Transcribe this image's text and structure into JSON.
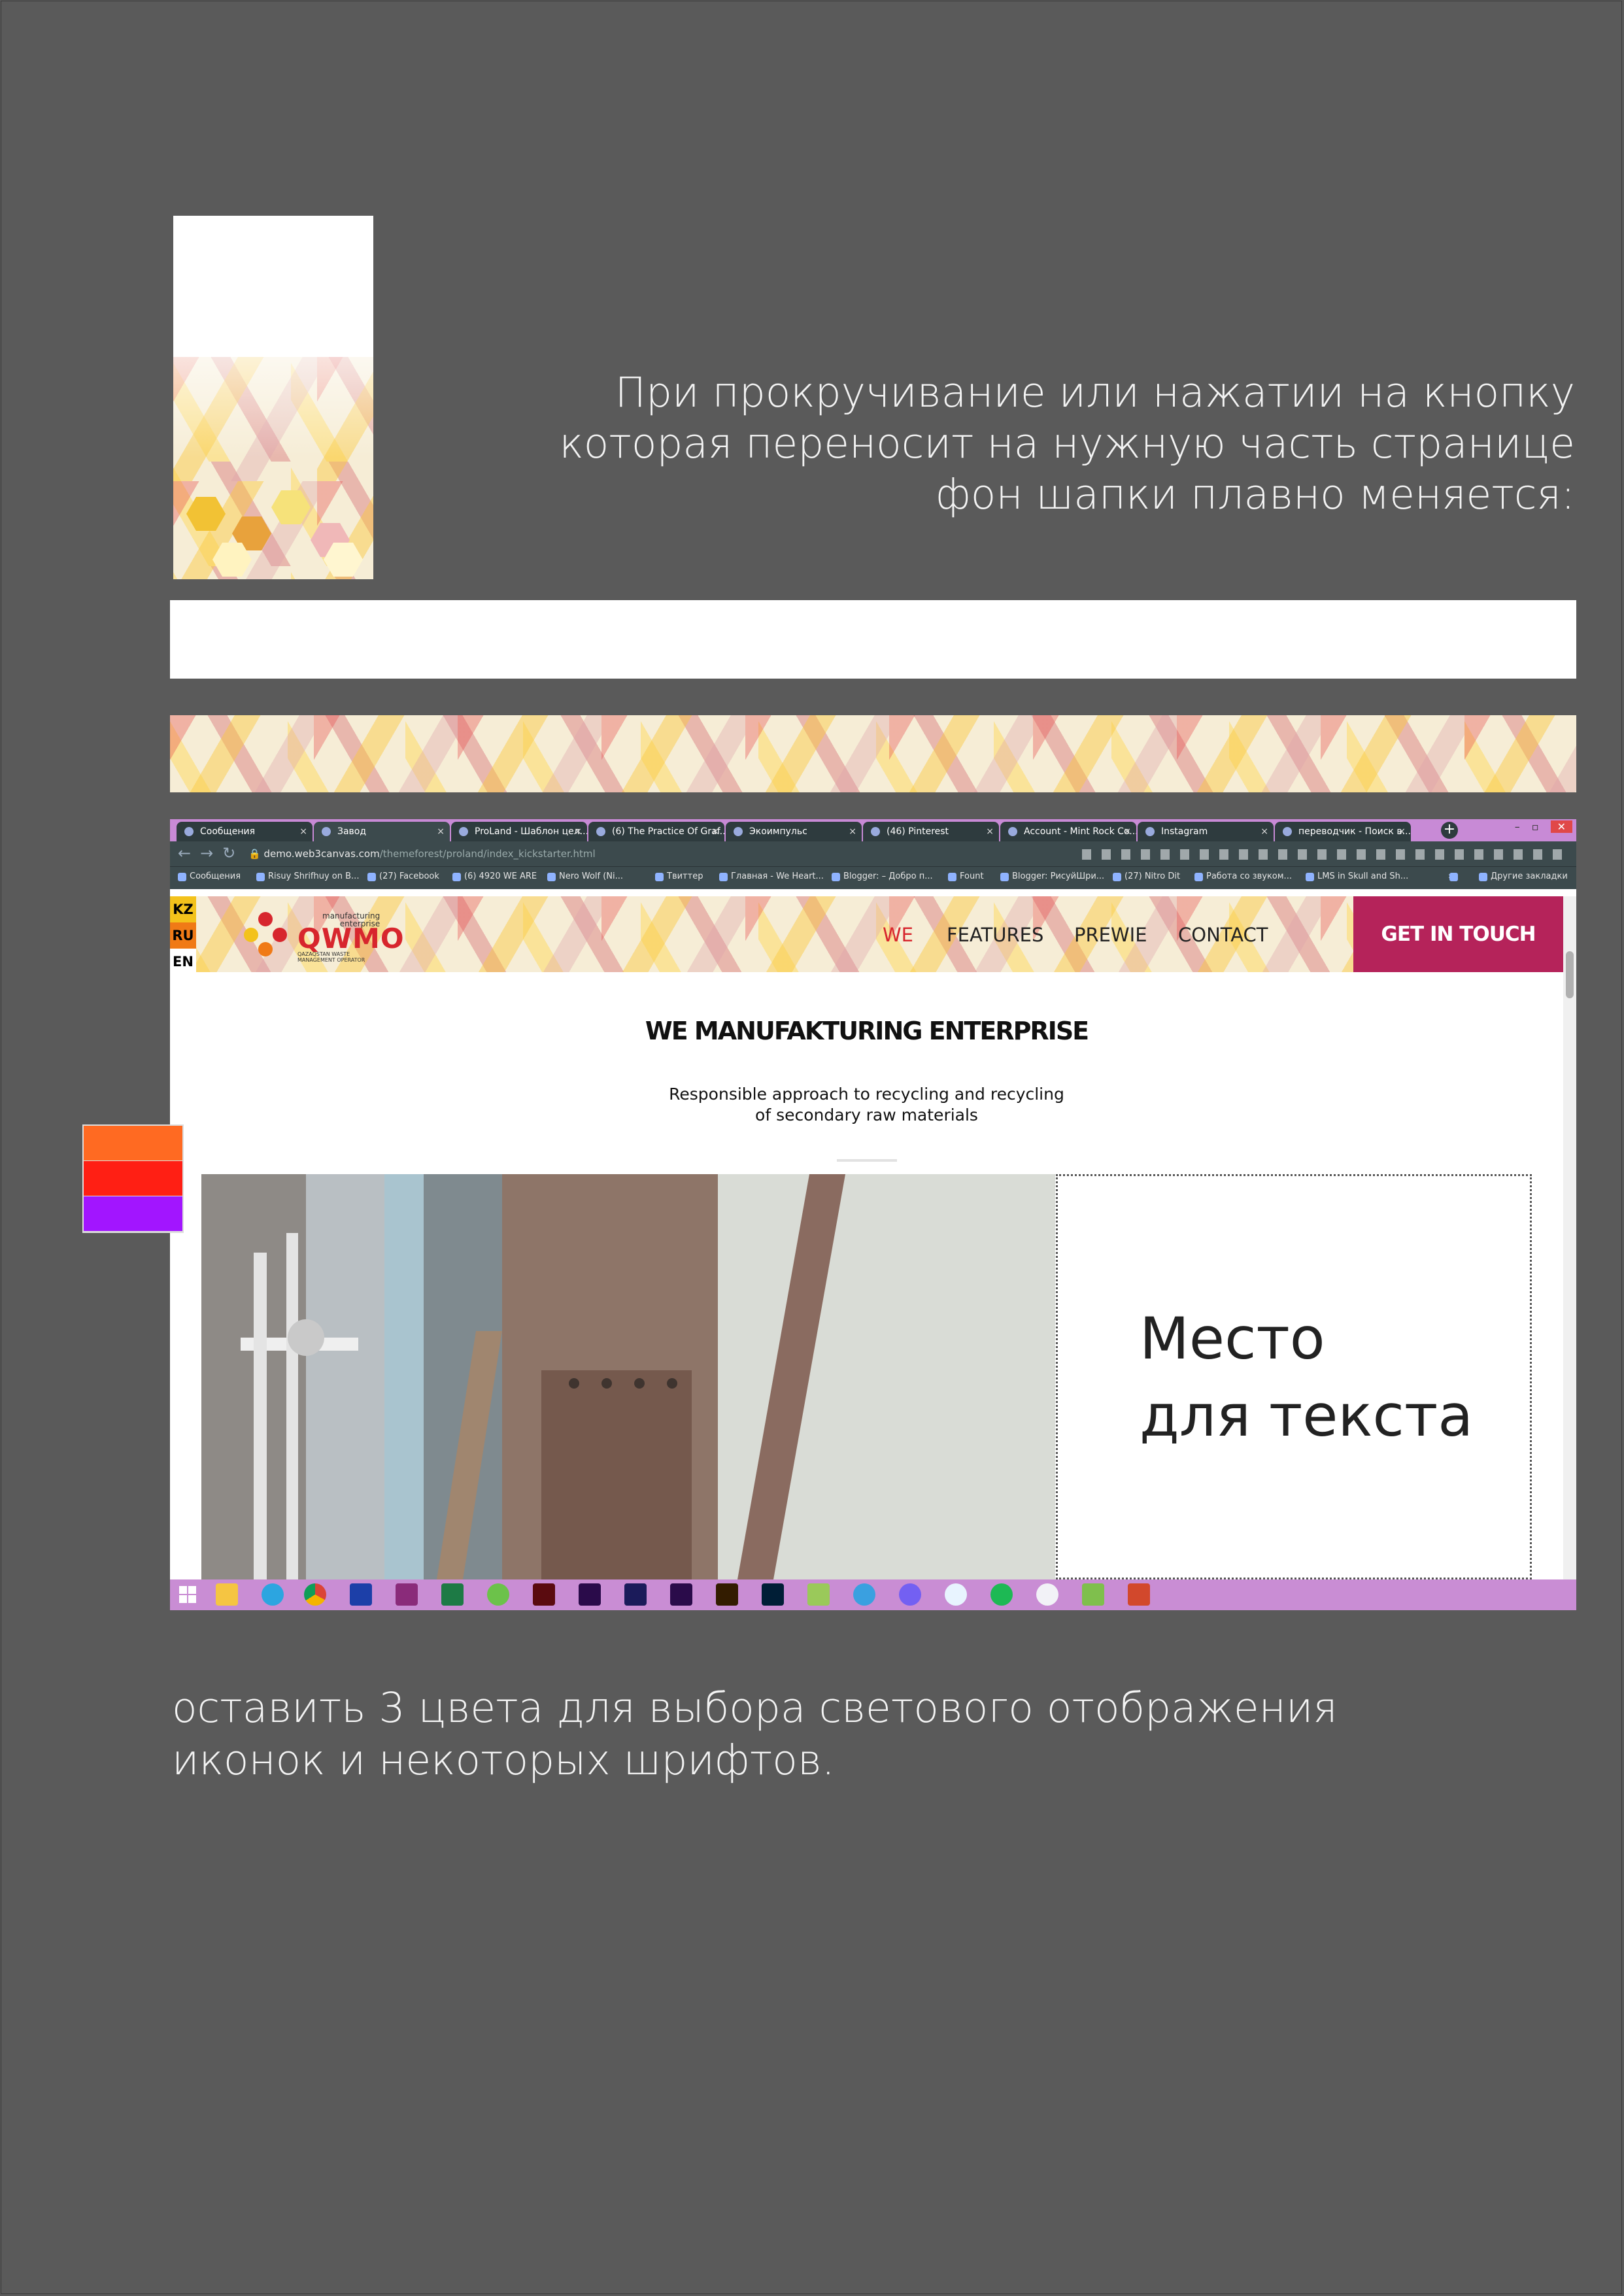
{
  "headline": {
    "line1": "При прокручивание или нажатии на кнопку",
    "line2": "которая переносит на нужную часть странице",
    "line3": "фон шапки плавно меняется:"
  },
  "browser": {
    "tabs": [
      "Сообщения",
      "Завод",
      "ProLand - Шаблон цел...",
      "(6) The Practice Of Graf...",
      "Экоимпульс",
      "(46) Pinterest",
      "Account - Mint Rock Co...",
      "Instagram",
      "переводчик - Поиск в..."
    ],
    "tab_close": "×",
    "new_tab": "+",
    "url_host": "demo.web3canvas.com",
    "url_path": "/themeforest/proland/index_kickstarter.html",
    "bookmarks": [
      "Сообщения",
      "Risuy Shrifhuy on B...",
      "(27) Facebook",
      "(6) 4920 WE ARE",
      "Nero Wolf (Ni...",
      "Твиттер",
      "Главная - We Heart...",
      "Blogger: – Добро п...",
      "Fount",
      "Blogger: РисуйШри...",
      "(27) Nitro Dit",
      "Работа со звуком...",
      "LMS in Skull and Sh...",
      "»",
      "Другие закладки"
    ]
  },
  "site": {
    "languages": [
      "KZ",
      "RU",
      "EN"
    ],
    "logo": {
      "name": "QWMO",
      "tagline_1": "manufacturing",
      "tagline_2": "enterprise",
      "sub_1": "QAZAQSTAN WASTE",
      "sub_2": "MANAGEMENT OPERATOR"
    },
    "menu": [
      "WE",
      "FEATURES",
      "PREWIE",
      "CONTACT"
    ],
    "cta": "GET IN TOUCH",
    "title": "WE MANUFAKTURING ENTERPRISE",
    "subtitle_1": "Responsible approach to recycling and recycling",
    "subtitle_2": "of secondary raw materials",
    "placeholder_1": "Место",
    "placeholder_2": "для текста"
  },
  "colors": {
    "menu_active": "#d7262d",
    "cta_background": "#b5235a",
    "lang_kz": "#f3c21b",
    "lang_ru": "#f07a16",
    "swatch_orange": "#ff6a22",
    "swatch_red": "#ff1f14",
    "swatch_purple": "#a215ff"
  },
  "taskbar_icons": [
    "windows-start-icon",
    "file-explorer-icon",
    "telegram-icon",
    "chrome-icon",
    "save-icon",
    "winrar-icon",
    "excel-icon",
    "torrent-icon",
    "animate-icon",
    "character-animator-icon",
    "adobe-dimension-icon",
    "premiere-icon",
    "illustrator-icon",
    "photoshop-icon",
    "script-icon",
    "clock-24-icon",
    "viber-icon",
    "shazam-icon",
    "spotify-icon",
    "itunes-icon",
    "feather-icon",
    "acrobat-icon"
  ],
  "footnote": {
    "line1": "оставить 3 цвета для выбора светового отображения",
    "line2": "иконок и некоторых шрифтов."
  }
}
